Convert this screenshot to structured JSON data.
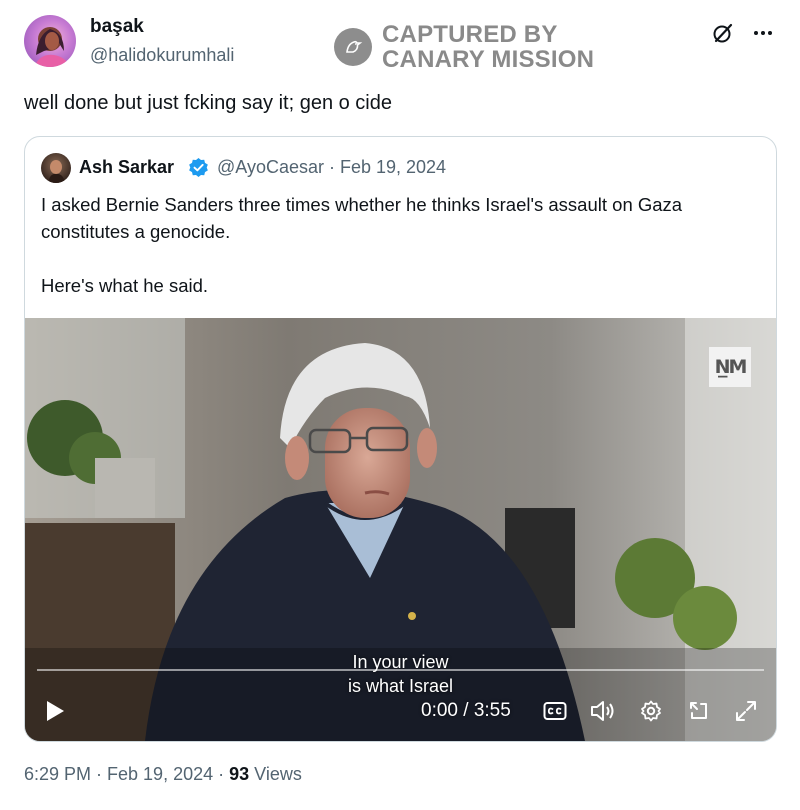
{
  "tweet": {
    "author_name": "başak",
    "author_handle": "@halidokurumhali",
    "text": "well done but just fcking say it; gen o cide",
    "timestamp": "6:29 PM · Feb 19, 2024",
    "separator": " · ",
    "views_count": "93",
    "views_label": "Views"
  },
  "watermark": {
    "line1": "CAPTURED BY",
    "line2": "CANARY MISSION",
    "icon": "canary-bird-icon"
  },
  "header_icons": [
    "grok-icon",
    "more-icon"
  ],
  "quoted": {
    "author_name": "Ash Sarkar",
    "verified": true,
    "meta": "@AyoCaesar · Feb 19, 2024",
    "paragraph1": "I asked Bernie Sanders three times whether he thinks Israel's assault on Gaza constitutes  a genocide.",
    "paragraph2": "Here's what he said."
  },
  "video": {
    "logo_text": "N̲M",
    "caption_line1": "In your view",
    "caption_line2": "is what Israel",
    "time": "0:00 / 3:55",
    "progress": 0,
    "controls": [
      "play-icon",
      "captions-icon",
      "volume-icon",
      "settings-icon",
      "share-icon",
      "fullscreen-icon"
    ]
  },
  "colors": {
    "secondary_text": "#536471",
    "verified_blue": "#1d9bf0",
    "border": "#cfd9de"
  }
}
